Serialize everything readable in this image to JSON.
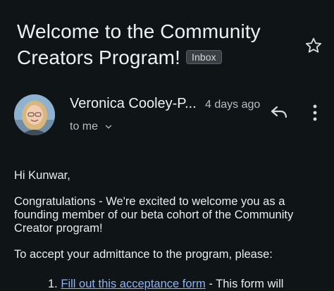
{
  "email": {
    "subject_line1": "Welcome to the Community",
    "subject_line2": "Creators Program!",
    "label_badge": "Inbox",
    "sender": "Veronica Cooley-P...",
    "date": "4 days ago",
    "recipient": "to me"
  },
  "body": {
    "greeting": "Hi Kunwar,",
    "para1": "Congratulations - We're excited to welcome you as a founding member of our beta cohort of the Community Creator program!",
    "para2": "To accept your admittance to the program, please:",
    "list_number": "1.",
    "list_link": "Fill out this acceptance form",
    "list_rest": " - This form will"
  },
  "icons": {
    "star": "star-icon",
    "reply": "reply-icon",
    "more": "more-vert-icon",
    "expand": "chevron-down-icon"
  },
  "colors": {
    "background": "#0f1416",
    "link": "#8ab4f8"
  }
}
